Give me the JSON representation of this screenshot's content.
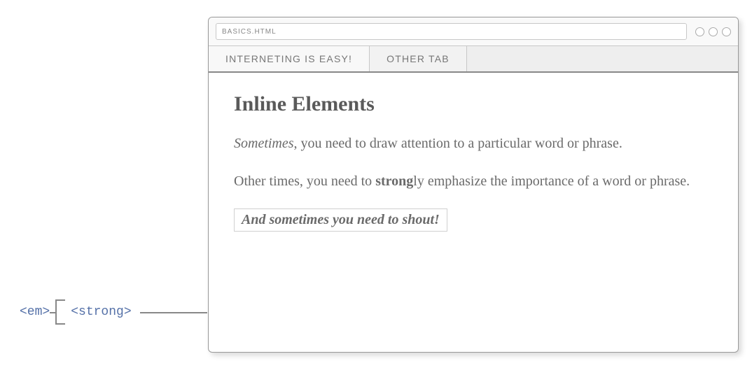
{
  "browser": {
    "address": "BASICS.HTML",
    "tabs": [
      {
        "label": "INTERNETING IS EASY!"
      },
      {
        "label": "OTHER TAB"
      }
    ]
  },
  "content": {
    "heading": "Inline Elements",
    "p1_em": "Sometimes",
    "p1_rest": ", you need to draw attention to a particular word or phrase.",
    "p2_pre": "Other times, you need to ",
    "p2_strong": "strong",
    "p2_post": "ly emphasize the importance of a word or phrase.",
    "shout": "And sometimes you need to shout!"
  },
  "annotation": {
    "em_tag": "<em>",
    "strong_tag": "<strong>"
  }
}
